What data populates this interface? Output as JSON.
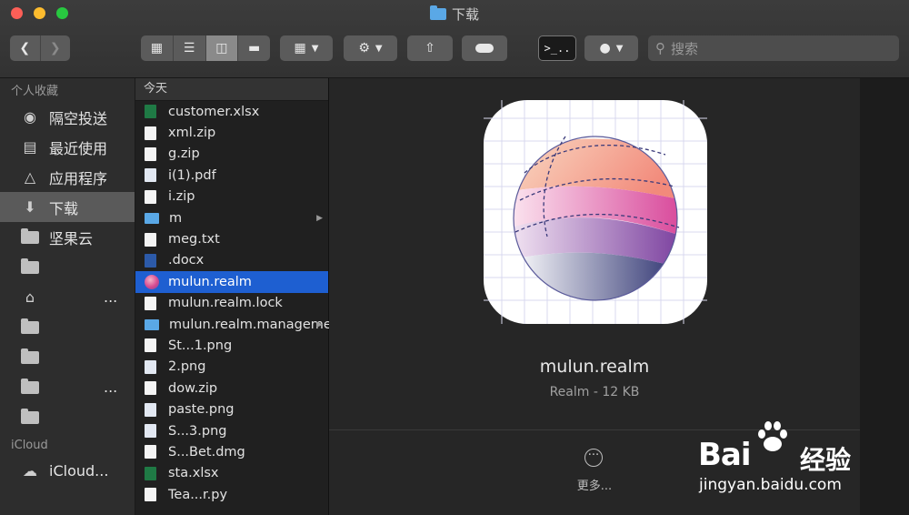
{
  "window": {
    "title": "下载"
  },
  "toolbar": {
    "search_placeholder": "搜索",
    "action_icon": "gear-icon",
    "share_icon": "share-icon",
    "tag_icon": "tag-icon",
    "terminal_icon": "terminal-icon"
  },
  "sidebar": {
    "favorites_header": "个人收藏",
    "items": [
      {
        "label": "隔空投送",
        "icon": "airdrop-icon"
      },
      {
        "label": "最近使用",
        "icon": "recents-icon"
      },
      {
        "label": "应用程序",
        "icon": "applications-icon"
      },
      {
        "label": "下载",
        "icon": "downloads-icon",
        "selected": true
      },
      {
        "label": "坚果云",
        "icon": "folder-icon"
      },
      {
        "label": "",
        "icon": "folder-icon"
      },
      {
        "label": "...",
        "icon": "home-icon"
      },
      {
        "label": "",
        "icon": "folder-icon"
      },
      {
        "label": "",
        "icon": "folder-icon"
      },
      {
        "label": "...",
        "icon": "folder-icon"
      },
      {
        "label": "",
        "icon": "folder-icon"
      }
    ],
    "icloud_header": "iCloud",
    "icloud_item": "iCloud..."
  },
  "column": {
    "header": "今天",
    "rows": [
      {
        "name": "customer.xlsx",
        "type": "x"
      },
      {
        "name": "xml.zip",
        "type": "d"
      },
      {
        "name": "g.zip",
        "type": "d"
      },
      {
        "name": "i(1).pdf",
        "type": "p"
      },
      {
        "name": "i.zip",
        "type": "d"
      },
      {
        "name": "m",
        "type": "f",
        "folder": true
      },
      {
        "name": "meg.txt",
        "type": "d"
      },
      {
        "name": ".docx",
        "type": "w"
      },
      {
        "name": "mulun.realm",
        "type": "r",
        "selected": true
      },
      {
        "name": "mulun.realm.lock",
        "type": "d"
      },
      {
        "name": "mulun.realm.management",
        "type": "f",
        "folder": true
      },
      {
        "name": "St...1.png",
        "type": "d"
      },
      {
        "name": "2.png",
        "type": "p"
      },
      {
        "name": "dow.zip",
        "type": "d"
      },
      {
        "name": "paste.png",
        "type": "p"
      },
      {
        "name": "S...3.png",
        "type": "p"
      },
      {
        "name": "S...Bet.dmg",
        "type": "d"
      },
      {
        "name": "sta.xlsx",
        "type": "x"
      },
      {
        "name": "Tea...r.py",
        "type": "d"
      }
    ]
  },
  "preview": {
    "name": "mulun.realm",
    "meta": "Realm - 12 KB",
    "more_label": "更多..."
  },
  "watermark": {
    "logo": "Bai",
    "cn": "经验",
    "url": "jingyan.baidu.com"
  }
}
